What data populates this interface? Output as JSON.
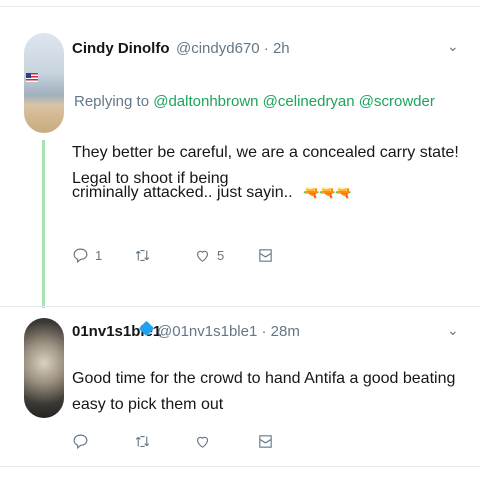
{
  "tweet1": {
    "name": "Cindy Dinolfo",
    "handle_time": "@cindyd670 · 2h",
    "replying_prefix": "Replying to ",
    "replying_to": "@daltonhbrown @celinedryan @scrowder",
    "line1": "They better be careful, we are a concealed carry state! Legal to shoot if being",
    "line2": "criminally attacked.. just sayin..",
    "emojis": "🔫🔫🔫",
    "reply_count": "1",
    "like_count": "5"
  },
  "tweet2": {
    "name": "01nv1s1ble1",
    "handle_time": "@01nv1s1ble1 · 28m",
    "text": "Good time for the crowd to hand Antifa a good beating easy to pick them out"
  },
  "icons": {
    "chevron": "⌄",
    "reply": "reply-icon",
    "retweet": "retweet-icon",
    "like": "heart-icon",
    "message": "message-icon"
  },
  "colors": {
    "link": "#1da35e",
    "meta": "#657786",
    "verified": "#1da1f2",
    "thread_line": "#a7e3b2"
  }
}
